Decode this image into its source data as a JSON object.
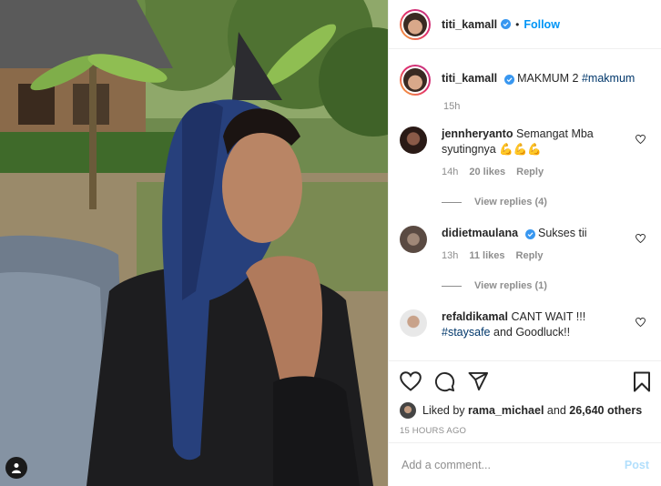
{
  "post": {
    "username": "titi_kamall",
    "follow_label": "Follow",
    "dot": "•",
    "caption_text": "MAKMUM 2",
    "caption_hashtag": "#makmum",
    "caption_time": "15h"
  },
  "comments": [
    {
      "username": "jennheryanto",
      "verified": false,
      "text": "Semangat Mba syutingnya 💪💪💪",
      "time": "14h",
      "likes": "20 likes",
      "reply_label": "Reply",
      "view_replies": "View replies (4)"
    },
    {
      "username": "didietmaulana",
      "verified": true,
      "text": "Sukses tii",
      "time": "13h",
      "likes": "11 likes",
      "reply_label": "Reply",
      "view_replies": "View replies (1)"
    },
    {
      "username": "refaldikamal",
      "verified": false,
      "text": "CANT WAIT !!!",
      "hashtag": "#staysafe",
      "text2": "and Goodluck!!"
    }
  ],
  "actions": {
    "liked_by_prefix": "Liked by",
    "liked_by_user": "rama_michael",
    "liked_by_and": "and",
    "liked_by_others": "26,640 others",
    "post_time": "15 HOURS AGO"
  },
  "add_comment": {
    "placeholder": "Add a comment...",
    "post_label": "Post"
  },
  "colors": {
    "link_blue": "#0095f6",
    "verified_blue": "#3897f0",
    "hashtag": "#00376b",
    "muted": "#8e8e8e"
  },
  "icons": [
    "person-tag-icon",
    "verified-badge-icon",
    "heart-icon",
    "comment-icon",
    "share-icon",
    "bookmark-icon"
  ]
}
